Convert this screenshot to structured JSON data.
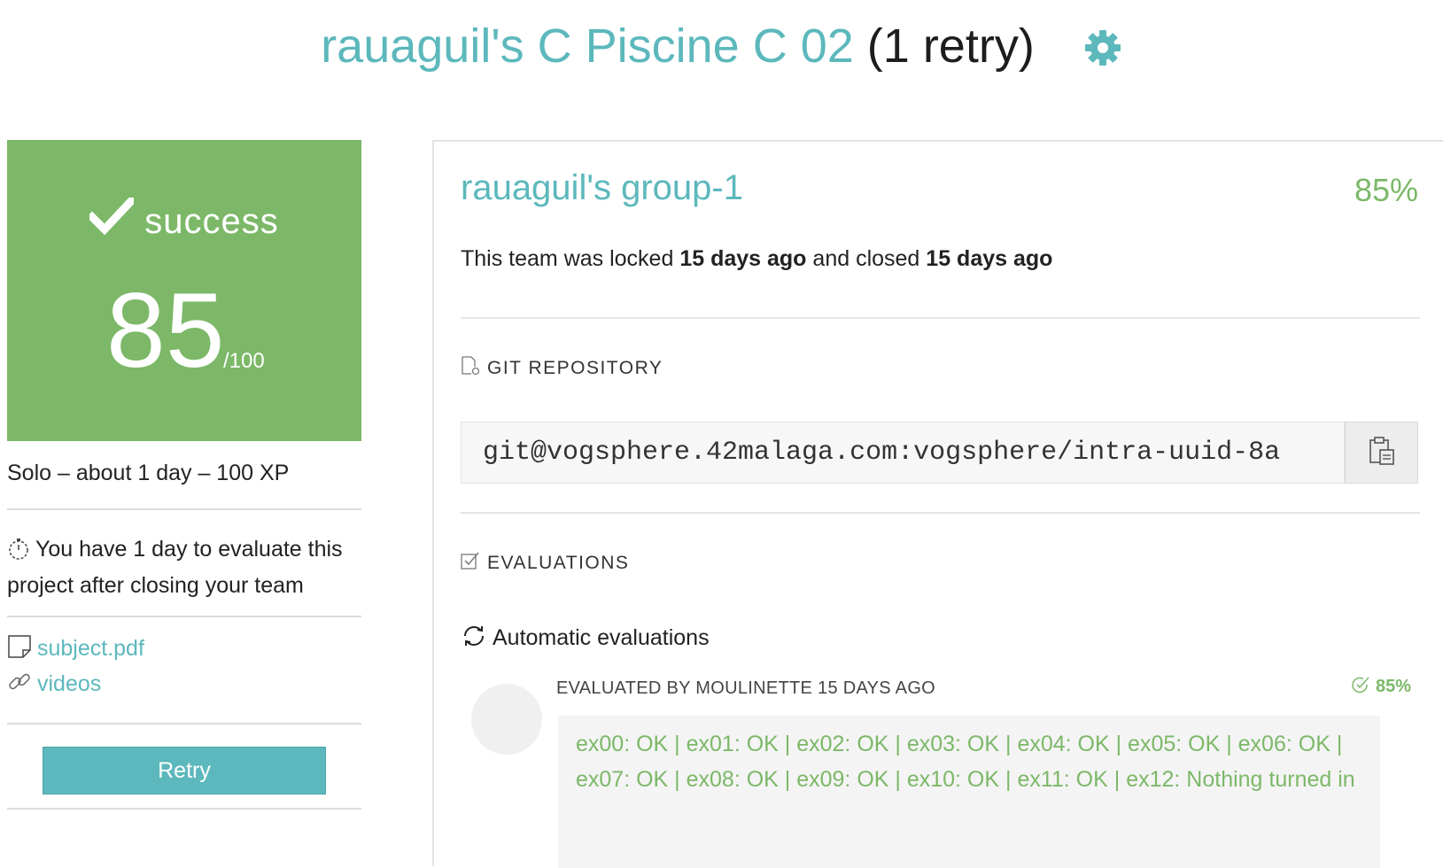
{
  "header": {
    "title": "rauaguil's C Piscine C 02",
    "retry_note": "(1 retry)",
    "settings_icon": "gear-icon"
  },
  "project": {
    "status": "success",
    "score": "85",
    "max_score": "/100",
    "meta": "Solo – about 1 day – 100 XP",
    "evaluate_note": "You have 1 day to evaluate this project after closing your team",
    "subject_link": "subject.pdf",
    "videos_link": "videos",
    "retry_label": "Retry"
  },
  "team": {
    "name": "rauaguil's group-1",
    "score": "85%",
    "status_prefix": "This team was locked ",
    "locked_when": "15 days ago",
    "status_middle": " and closed ",
    "closed_when": "15 days ago"
  },
  "repository": {
    "label": "GIT REPOSITORY",
    "url": "git@vogsphere.42malaga.com:vogsphere/intra-uuid-8a"
  },
  "evaluations": {
    "label": "EVALUATIONS",
    "auto_label": "Automatic evaluations",
    "evaluator": "EVALUATED BY MOULINETTE 15 DAYS AGO",
    "score": "85%",
    "output": "ex00: OK | ex01: OK | ex02: OK | ex03: OK | ex04: OK | ex05: OK | ex06: OK | ex07: OK | ex08: OK | ex09: OK | ex10: OK | ex11: OK | ex12: Nothing turned in"
  },
  "colors": {
    "accent": "#5cb8bc",
    "success": "#7cb868"
  }
}
